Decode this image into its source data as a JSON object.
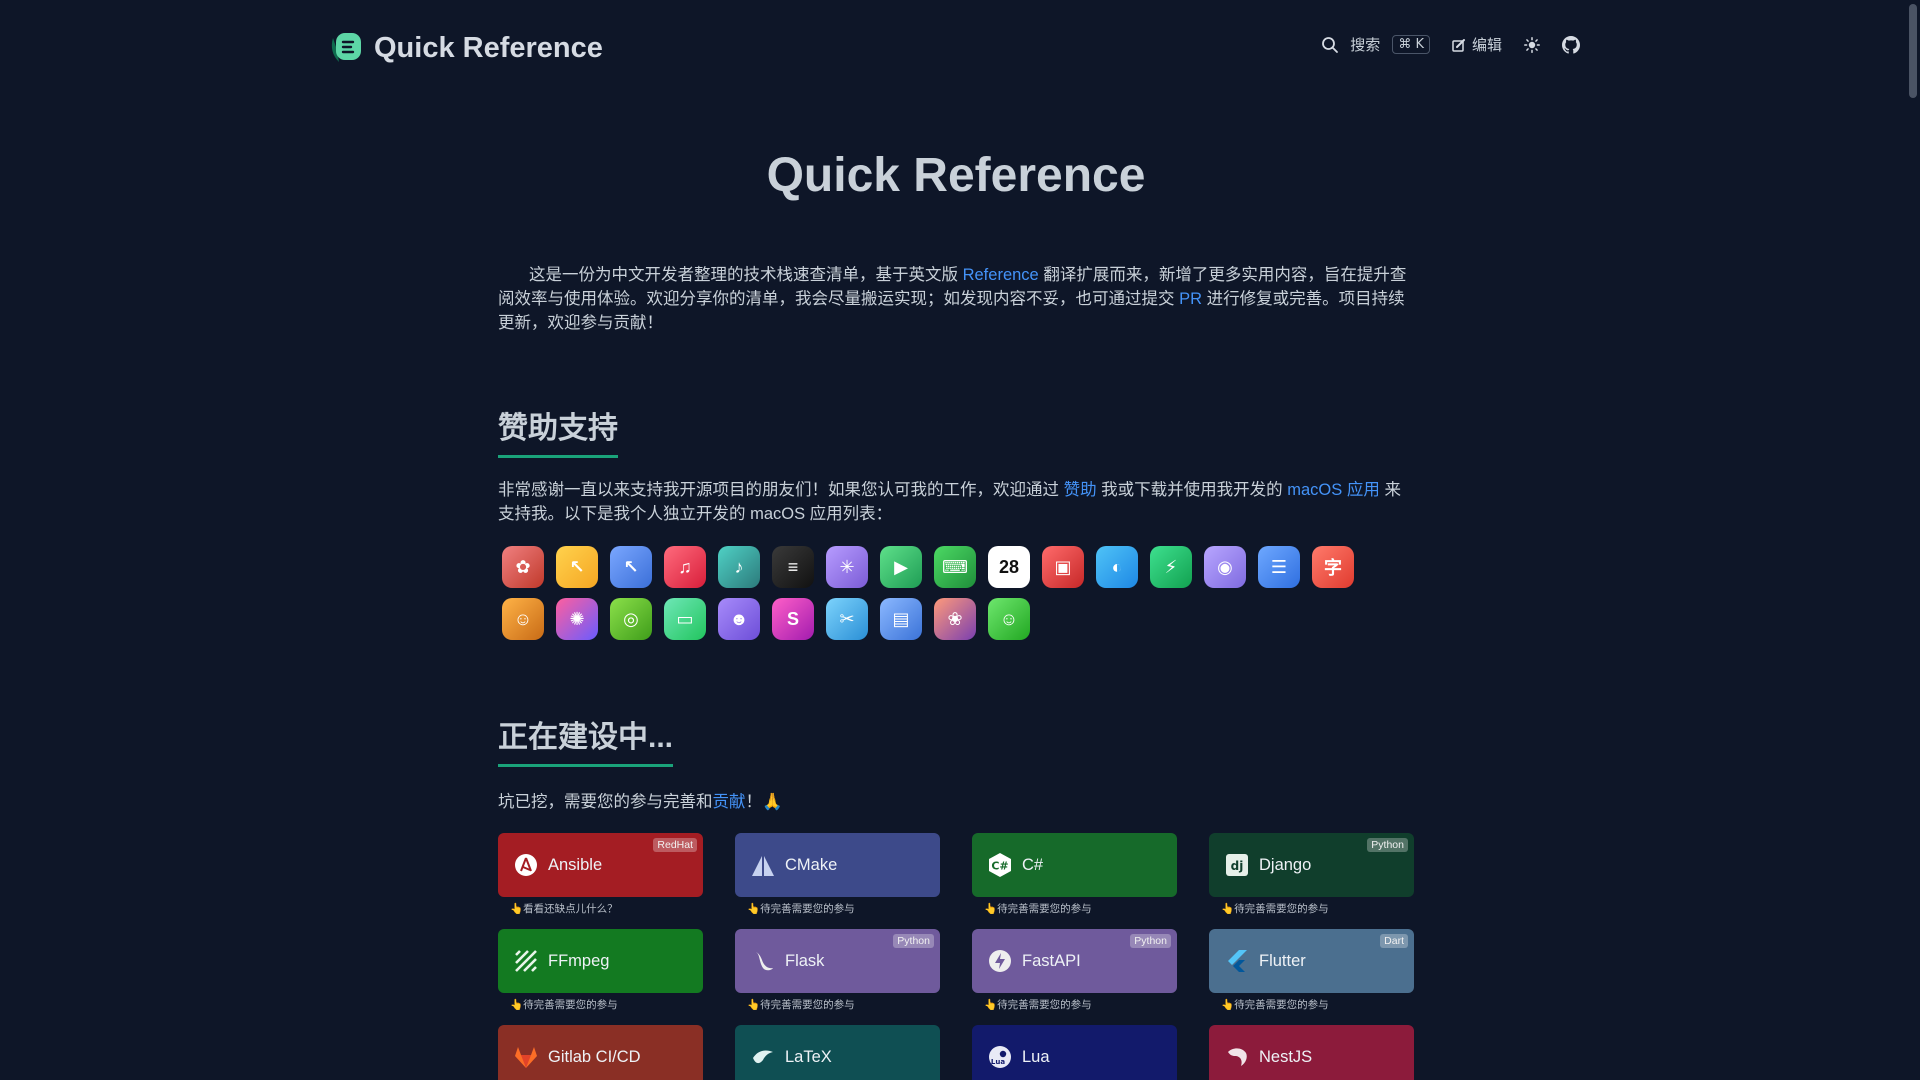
{
  "header": {
    "brand_title": "Quick Reference",
    "search_label": "搜索",
    "search_shortcut": "⌘ K",
    "edit_label": "编辑"
  },
  "hero": {
    "title": "Quick Reference"
  },
  "intro": {
    "part1": "这是一份为中文开发者整理的技术栈速查清单，基于英文版 ",
    "link1": "Reference",
    "part2": " 翻译扩展而来，新增了更多实用内容，旨在提升查阅效率与使用体验。欢迎分享你的清单，我会尽量搬运实现；如发现内容不妥，也可通过提交 ",
    "link2": "PR",
    "part3": " 进行修复或完善。项目持续更新，欢迎参与贡献！"
  },
  "sponsor": {
    "title": "赞助支持",
    "part1": "非常感谢一直以来支持我开源项目的朋友们！如果您认可我的工作，欢迎通过 ",
    "link1": "赞助",
    "part2": " 我或下载并使用我开发的 ",
    "link2": "macOS 应用",
    "part3": " 来支持我。以下是我个人独立开发的 macOS 应用列表："
  },
  "apps": [
    [
      {
        "icon": "aperture-app-icon",
        "bg": "linear-gradient(135deg,#f08080,#c0392b)",
        "glyph": "✿"
      },
      {
        "icon": "cursor-note-app-icon",
        "bg": "linear-gradient(135deg,#ffd24d,#f5a623)",
        "glyph": "↖"
      },
      {
        "icon": "cursor-app-icon",
        "bg": "linear-gradient(135deg,#7aa7ff,#3b6fd8)",
        "glyph": "↖"
      },
      {
        "icon": "music-app-icon",
        "bg": "linear-gradient(135deg,#ff6b7d,#d81e3a)",
        "glyph": "♫"
      },
      {
        "icon": "music-note-app-icon",
        "bg": "linear-gradient(135deg,#4fd1c5,#2c7a7b)",
        "glyph": "♪"
      },
      {
        "icon": "terminal-app-icon",
        "bg": "linear-gradient(135deg,#3a3a3a,#111111)",
        "glyph": "≡"
      },
      {
        "icon": "sparkle-app-icon",
        "bg": "linear-gradient(135deg,#b79cff,#7b5cd6)",
        "glyph": "✳"
      },
      {
        "icon": "play-app-icon",
        "bg": "linear-gradient(135deg,#5ee08a,#1f9d55)",
        "glyph": "▶"
      },
      {
        "icon": "keyboard-app-icon",
        "bg": "linear-gradient(135deg,#4cd964,#1f8f3a)",
        "glyph": "⌨"
      },
      {
        "icon": "calendar-app-icon",
        "bg": "#ffffff",
        "glyph": "28",
        "color": "#111111"
      },
      {
        "icon": "image-app-icon",
        "bg": "linear-gradient(135deg,#ff6b6b,#c62828)",
        "glyph": "▣"
      },
      {
        "icon": "chat-app-icon",
        "bg": "linear-gradient(135deg,#4fc3f7,#1e88e5)",
        "glyph": "◐"
      },
      {
        "icon": "bolt-app-icon",
        "bg": "linear-gradient(135deg,#3ee08f,#12a150)",
        "glyph": "⚡"
      },
      {
        "icon": "rss-app-icon",
        "bg": "linear-gradient(135deg,#b8a6ff,#7f6be0)",
        "glyph": "◉"
      },
      {
        "icon": "list-app-icon",
        "bg": "linear-gradient(135deg,#6ea8ff,#2f6fe0)",
        "glyph": "☰"
      },
      {
        "icon": "translate-app-icon",
        "bg": "linear-gradient(135deg,#ff7a6b,#e03b2f)",
        "glyph": "字"
      }
    ],
    [
      {
        "icon": "mascot-app-icon",
        "bg": "linear-gradient(135deg,#ffb347,#c86b16)",
        "glyph": "☺"
      },
      {
        "icon": "colorful-app-icon",
        "bg": "linear-gradient(135deg,#ff5f9e,#6a5cff)",
        "glyph": "✺"
      },
      {
        "icon": "webcam-app-icon",
        "bg": "linear-gradient(135deg,#8be04a,#3f9d1a)",
        "glyph": "◎"
      },
      {
        "icon": "window-app-icon",
        "bg": "linear-gradient(135deg,#6ee7b7,#22c55e)",
        "glyph": "▭"
      },
      {
        "icon": "contacts-app-icon",
        "bg": "linear-gradient(135deg,#a78bfa,#6d4ed8)",
        "glyph": "☻"
      },
      {
        "icon": "s-app-icon",
        "bg": "linear-gradient(135deg,#ff5fc8,#a21caf)",
        "glyph": "S"
      },
      {
        "icon": "tools-app-icon",
        "bg": "linear-gradient(135deg,#7dd3fc,#2a8fd6)",
        "glyph": "✂"
      },
      {
        "icon": "document-app-icon",
        "bg": "linear-gradient(135deg,#8bb8ff,#3b73d8)",
        "glyph": "▤"
      },
      {
        "icon": "photo-app-icon",
        "bg": "linear-gradient(135deg,#ff9a7a,#7a3fb0)",
        "glyph": "❀"
      },
      {
        "icon": "smile-app-icon",
        "bg": "linear-gradient(135deg,#6ee76e,#22a722)",
        "glyph": "☺"
      }
    ]
  ],
  "build": {
    "title": "正在建设中...",
    "part1": "坑已挖，需要您的参与完善和",
    "link": "贡献",
    "part2": "！🙏"
  },
  "cards": [
    {
      "name": "Ansible",
      "badge": "RedHat",
      "note": "👆看看还缺点儿什么？",
      "bg": "#a41d23",
      "icon": "ansible-icon"
    },
    {
      "name": "CMake",
      "badge": "",
      "note": "👆待完善需要您的参与",
      "bg": "#3d4a8a",
      "icon": "cmake-icon"
    },
    {
      "name": "C#",
      "badge": "",
      "note": "👆待完善需要您的参与",
      "bg": "#166a2a",
      "icon": "csharp-icon"
    },
    {
      "name": "Django",
      "badge": "Python",
      "note": "👆待完善需要您的参与",
      "bg": "#103e2c",
      "icon": "django-icon"
    },
    {
      "name": "FFmpeg",
      "badge": "",
      "note": "👆待完善需要您的参与",
      "bg": "#137a21",
      "icon": "ffmpeg-icon"
    },
    {
      "name": "Flask",
      "badge": "Python",
      "note": "👆待完善需要您的参与",
      "bg": "#6f5a9c",
      "icon": "flask-icon"
    },
    {
      "name": "FastAPI",
      "badge": "Python",
      "note": "👆待完善需要您的参与",
      "bg": "#6f5a9c",
      "icon": "fastapi-icon"
    },
    {
      "name": "Flutter",
      "badge": "Dart",
      "note": "👆待完善需要您的参与",
      "bg": "#4b6f8f",
      "icon": "flutter-icon"
    },
    {
      "name": "Gitlab CI/CD",
      "badge": "",
      "note": "",
      "bg": "#8a2f25",
      "icon": "gitlab-icon"
    },
    {
      "name": "LaTeX",
      "badge": "",
      "note": "",
      "bg": "#0f4f53",
      "icon": "latex-icon"
    },
    {
      "name": "Lua",
      "badge": "",
      "note": "",
      "bg": "#121a6b",
      "icon": "lua-icon"
    },
    {
      "name": "NestJS",
      "badge": "",
      "note": "",
      "bg": "#8c1b3b",
      "icon": "nestjs-icon"
    }
  ]
}
